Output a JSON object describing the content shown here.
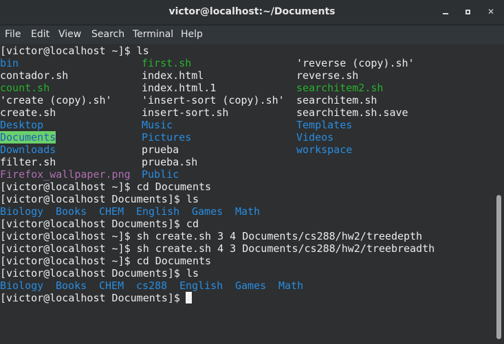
{
  "window": {
    "title": "victor@localhost:~/Documents",
    "controls": {
      "minimize": "",
      "maximize": "",
      "close": "✕"
    }
  },
  "menu": [
    "File",
    "Edit",
    "View",
    "Search",
    "Terminal",
    "Help"
  ],
  "colors": {
    "default": "#ececec",
    "directory": "#2a8de0",
    "executable": "#29b12c",
    "image": "#b070b0",
    "highlight_bg": "#6bd16b"
  },
  "terminal_lines": [
    [
      {
        "t": "[victor@localhost ~]$ ls",
        "c": "default"
      }
    ],
    [
      {
        "t": "bin",
        "c": "blue"
      },
      {
        "t": "first.sh",
        "c": "green"
      },
      {
        "t": "'reverse (copy).sh'",
        "c": "default"
      }
    ],
    [
      {
        "t": "contador.sh",
        "c": "default"
      },
      {
        "t": "index.html",
        "c": "default"
      },
      {
        "t": "reverse.sh",
        "c": "default"
      }
    ],
    [
      {
        "t": "count.sh",
        "c": "green"
      },
      {
        "t": "index.html.1",
        "c": "default"
      },
      {
        "t": "searchitem2.sh",
        "c": "green"
      }
    ],
    [
      {
        "t": "'create (copy).sh'",
        "c": "default"
      },
      {
        "t": "'insert-sort (copy).sh'",
        "c": "default"
      },
      {
        "t": "searchitem.sh",
        "c": "default"
      }
    ],
    [
      {
        "t": "create.sh",
        "c": "default"
      },
      {
        "t": "insert-sort.sh",
        "c": "default"
      },
      {
        "t": "searchitem.sh.save",
        "c": "default"
      }
    ],
    [
      {
        "t": "Desktop",
        "c": "blue"
      },
      {
        "t": "Music",
        "c": "blue"
      },
      {
        "t": "Templates",
        "c": "blue"
      }
    ],
    [
      {
        "t": "Documents",
        "c": "hl"
      },
      {
        "t": "Pictures",
        "c": "blue"
      },
      {
        "t": "Videos",
        "c": "blue"
      }
    ],
    [
      {
        "t": "Downloads",
        "c": "blue"
      },
      {
        "t": "prueba",
        "c": "default"
      },
      {
        "t": "workspace",
        "c": "blue"
      }
    ],
    [
      {
        "t": "filter.sh",
        "c": "default"
      },
      {
        "t": "prueba.sh",
        "c": "default"
      }
    ],
    [
      {
        "t": "Firefox_wallpaper.png",
        "c": "magenta"
      },
      {
        "t": "Public",
        "c": "blue"
      }
    ],
    [
      {
        "t": "[victor@localhost ~]$ cd Documents",
        "c": "default"
      }
    ],
    [
      {
        "t": "[victor@localhost Documents]$ ls",
        "c": "default"
      }
    ],
    [
      {
        "t": "Biology",
        "c": "blue"
      },
      {
        "t": "Books",
        "c": "blue"
      },
      {
        "t": "CHEM",
        "c": "blue"
      },
      {
        "t": "English",
        "c": "blue"
      },
      {
        "t": "Games",
        "c": "blue"
      },
      {
        "t": "Math",
        "c": "blue"
      }
    ],
    [
      {
        "t": "[victor@localhost Documents]$ cd",
        "c": "default"
      }
    ],
    [
      {
        "t": "[victor@localhost ~]$ sh create.sh 3 4 Documents/cs288/hw2/treedepth",
        "c": "default"
      }
    ],
    [
      {
        "t": "[victor@localhost ~]$ sh create.sh 4 3 Documents/cs288/hw2/treebreadth",
        "c": "default"
      }
    ],
    [
      {
        "t": "[victor@localhost ~]$ cd Documents",
        "c": "default"
      }
    ],
    [
      {
        "t": "[victor@localhost Documents]$ ls",
        "c": "default"
      }
    ],
    [
      {
        "t": "Biology",
        "c": "blue"
      },
      {
        "t": "Books",
        "c": "blue"
      },
      {
        "t": "CHEM",
        "c": "blue"
      },
      {
        "t": "cs288",
        "c": "blue"
      },
      {
        "t": "English",
        "c": "blue"
      },
      {
        "t": "Games",
        "c": "blue"
      },
      {
        "t": "Math",
        "c": "blue"
      }
    ],
    [
      {
        "t": "[victor@localhost Documents]$ ",
        "c": "default"
      }
    ]
  ]
}
